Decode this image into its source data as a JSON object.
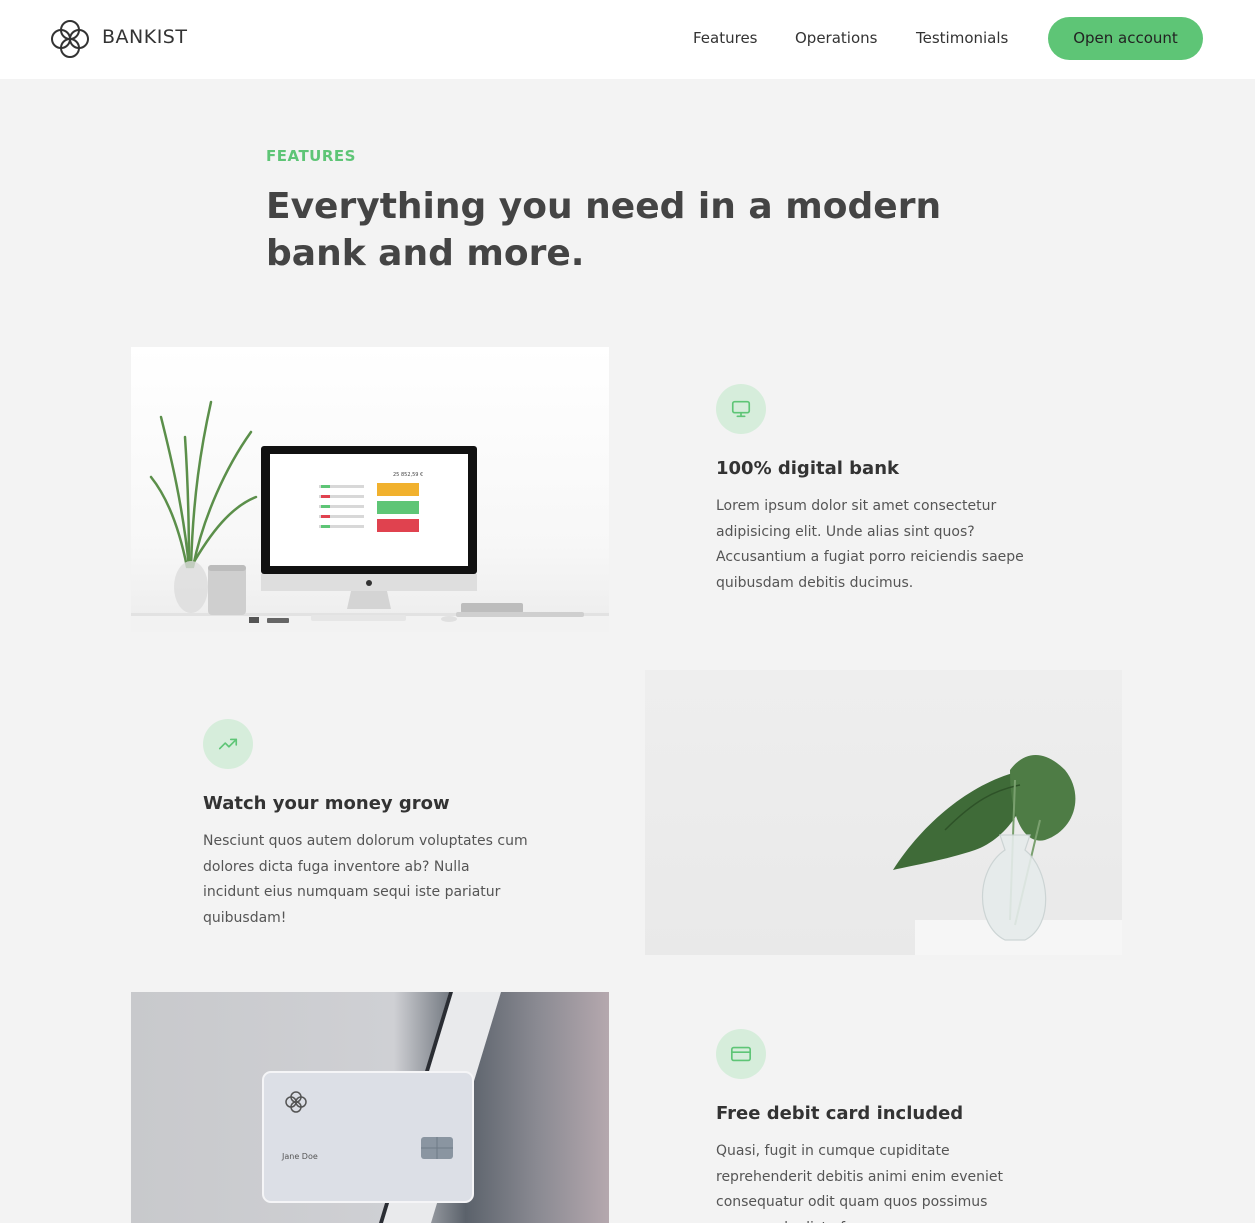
{
  "nav": {
    "brand": "BANKIST",
    "links": [
      "Features",
      "Operations",
      "Testimonials"
    ],
    "cta": "Open account"
  },
  "section": {
    "eyebrow": "FEATURES",
    "headline": "Everything you need in a modern bank and more."
  },
  "features": [
    {
      "icon": "monitor-icon",
      "title": "100% digital bank",
      "text": "Lorem ipsum dolor sit amet consectetur adipisicing elit. Unde alias sint quos? Accusantium a fugiat porro reiciendis saepe quibusdam debitis ducimus."
    },
    {
      "icon": "trending-up-icon",
      "title": "Watch your money grow",
      "text": "Nesciunt quos autem dolorum voluptates cum dolores dicta fuga inventore ab? Nulla incidunt eius numquam sequi iste pariatur quibusdam!"
    },
    {
      "icon": "credit-card-icon",
      "title": "Free debit card included",
      "text": "Quasi, fugit in cumque cupiditate reprehenderit debitis animi enim eveniet consequatur odit quam quos possimus assumenda dicta fuga"
    }
  ],
  "images": {
    "card_holder": "Jane Doe",
    "monitor_amount": "25 852,59 €"
  },
  "colors": {
    "accent": "#5ec576",
    "icon_bg": "#d6eddb",
    "background": "#f3f3f3"
  }
}
